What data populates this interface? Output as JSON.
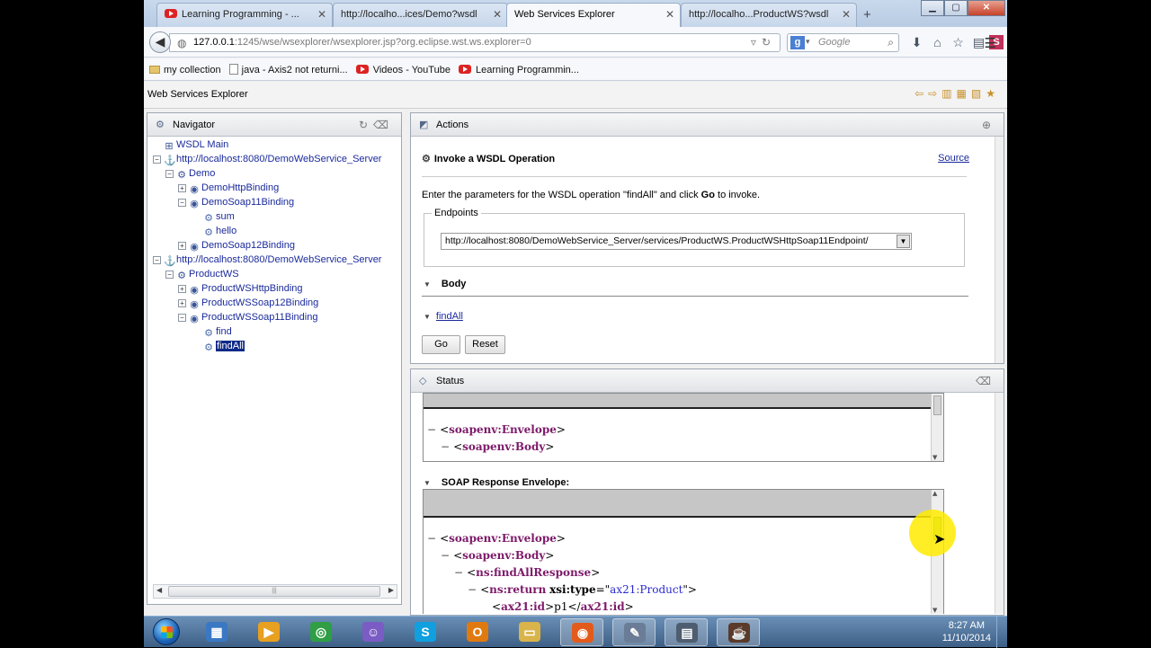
{
  "tabs": [
    {
      "label": "Learning Programming - ...",
      "active": false,
      "icon": "youtube-icon"
    },
    {
      "label": "http://localho...ices/Demo?wsdl",
      "active": false
    },
    {
      "label": "Web Services Explorer",
      "active": true
    },
    {
      "label": "http://localho...ProductWS?wsdl",
      "active": false
    }
  ],
  "tab_close": "✕",
  "new_tab": "+",
  "url": {
    "host": "127.0.0.1",
    "rest": ":1245/wse/wsexplorer/wsexplorer.jsp?org.eclipse.wst.ws.explorer=0"
  },
  "search": {
    "engine_letter": "g",
    "placeholder": "Google"
  },
  "bookmarks": [
    {
      "label": "my collection",
      "icon": "folder-icon"
    },
    {
      "label": "java - Axis2 not returni...",
      "icon": "page-icon"
    },
    {
      "label": "Videos - YouTube",
      "icon": "youtube-icon"
    },
    {
      "label": "Learning Programmin...",
      "icon": "youtube-icon"
    }
  ],
  "wse_title": "Web Services Explorer",
  "navigator": {
    "title": "Navigator",
    "nodes": [
      {
        "label": "WSDL Main",
        "depth": 0,
        "toggle": "",
        "icon": "wsdl-icon"
      },
      {
        "label": "http://localhost:8080/DemoWebService_Server",
        "depth": 1,
        "toggle": "−",
        "icon": "wsdl-service-icon"
      },
      {
        "label": "Demo",
        "depth": 2,
        "toggle": "−",
        "icon": "service-icon"
      },
      {
        "label": "DemoHttpBinding",
        "depth": 3,
        "toggle": "+",
        "icon": "binding-icon"
      },
      {
        "label": "DemoSoap11Binding",
        "depth": 3,
        "toggle": "−",
        "icon": "binding-icon"
      },
      {
        "label": "sum",
        "depth": 4,
        "toggle": "",
        "icon": "operation-icon"
      },
      {
        "label": "hello",
        "depth": 4,
        "toggle": "",
        "icon": "operation-icon"
      },
      {
        "label": "DemoSoap12Binding",
        "depth": 3,
        "toggle": "+",
        "icon": "binding-icon"
      },
      {
        "label": "http://localhost:8080/DemoWebService_Server",
        "depth": 1,
        "toggle": "−",
        "icon": "wsdl-service-icon"
      },
      {
        "label": "ProductWS",
        "depth": 2,
        "toggle": "−",
        "icon": "service-icon"
      },
      {
        "label": "ProductWSHttpBinding",
        "depth": 3,
        "toggle": "+",
        "icon": "binding-icon"
      },
      {
        "label": "ProductWSSoap12Binding",
        "depth": 3,
        "toggle": "+",
        "icon": "binding-icon"
      },
      {
        "label": "ProductWSSoap11Binding",
        "depth": 3,
        "toggle": "−",
        "icon": "binding-icon"
      },
      {
        "label": "find",
        "depth": 4,
        "toggle": "",
        "icon": "operation-icon"
      },
      {
        "label": "findAll",
        "depth": 4,
        "toggle": "",
        "icon": "operation-icon",
        "selected": true
      }
    ]
  },
  "actions": {
    "title": "Actions",
    "op_title": "Invoke a WSDL Operation",
    "source_link": "Source",
    "instruction_pre": "Enter the parameters for the WSDL operation \"findAll\" and click ",
    "instruction_bold": "Go",
    "instruction_post": " to invoke.",
    "endpoints_legend": "Endpoints",
    "endpoint_value": "http://localhost:8080/DemoWebService_Server/services/ProductWS.ProductWSHttpSoap11Endpoint/",
    "body_label": "Body",
    "findall_link": "findAll",
    "go_button": "Go",
    "reset_button": "Reset"
  },
  "status": {
    "title": "Status",
    "request_lines": [
      {
        "tag": "soapenv:Envelope",
        "indent": 0,
        "prefix": "−"
      },
      {
        "tag": "soapenv:Body",
        "indent": 1,
        "prefix": "−"
      }
    ],
    "response_header": "SOAP Response Envelope:",
    "response_lines": [
      {
        "tag": "soapenv:Envelope",
        "indent": 0,
        "prefix": "−"
      },
      {
        "tag": "soapenv:Body",
        "indent": 1,
        "prefix": "−"
      },
      {
        "tag": "ns:findAllResponse",
        "indent": 2,
        "prefix": "−"
      },
      {
        "tag": "ns:return",
        "indent": 3,
        "prefix": "−",
        "attr": "xsi:type",
        "value": "ax21:Product"
      },
      {
        "tag": "ax21:id",
        "indent": 4,
        "prefix": "",
        "text": "p1",
        "close": "ax21:id"
      }
    ]
  },
  "taskbar": {
    "apps": [
      "explorer",
      "media-player",
      "chrome",
      "messenger",
      "skype",
      "outlook",
      "folder",
      "firefox",
      "tools",
      "calculator",
      "java-ee"
    ],
    "time": "8:27 AM",
    "date": "11/10/2014"
  }
}
